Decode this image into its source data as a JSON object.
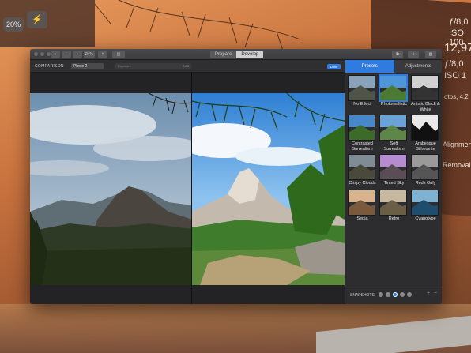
{
  "background": {
    "zoom_chip": "20%",
    "wand_chip": "⚡",
    "right_texts": [
      "ƒ/8,0",
      "ISO 100",
      "12,97",
      "ƒ/8,0",
      "ISO 1",
      "otos, 4.2",
      "Alignmen",
      "Removal"
    ]
  },
  "toolbar": {
    "zoom_value": "24%",
    "segment": {
      "prepare": "Prepare",
      "develop": "Develop"
    }
  },
  "comparison": {
    "label": "COMPARISON",
    "selected": "Photo 2",
    "slider_placeholder": "Exposure",
    "slider_value": "0,00",
    "done": "Done"
  },
  "sidebar": {
    "tabs": {
      "presets": "Presets",
      "adjustments": "Adjustments"
    },
    "presets": [
      {
        "label": "No Effect"
      },
      {
        "label": "Photorealistic"
      },
      {
        "label": "Artistic Black & White"
      },
      {
        "label": "Contrasted Surrealism"
      },
      {
        "label": "Soft Surrealism"
      },
      {
        "label": "Arabesque Silhouette"
      },
      {
        "label": "Crispy Clouds"
      },
      {
        "label": "Tinted Sky"
      },
      {
        "label": "Reds Only"
      },
      {
        "label": "Sepia"
      },
      {
        "label": "Retro"
      },
      {
        "label": "Cyanotype"
      }
    ],
    "snapshots_label": "SNAPSHOTS",
    "snapshot_count": 5,
    "active_snapshot": 3
  },
  "colors": {
    "accent": "#2f7be0",
    "window_bg": "#2b2b2d"
  }
}
